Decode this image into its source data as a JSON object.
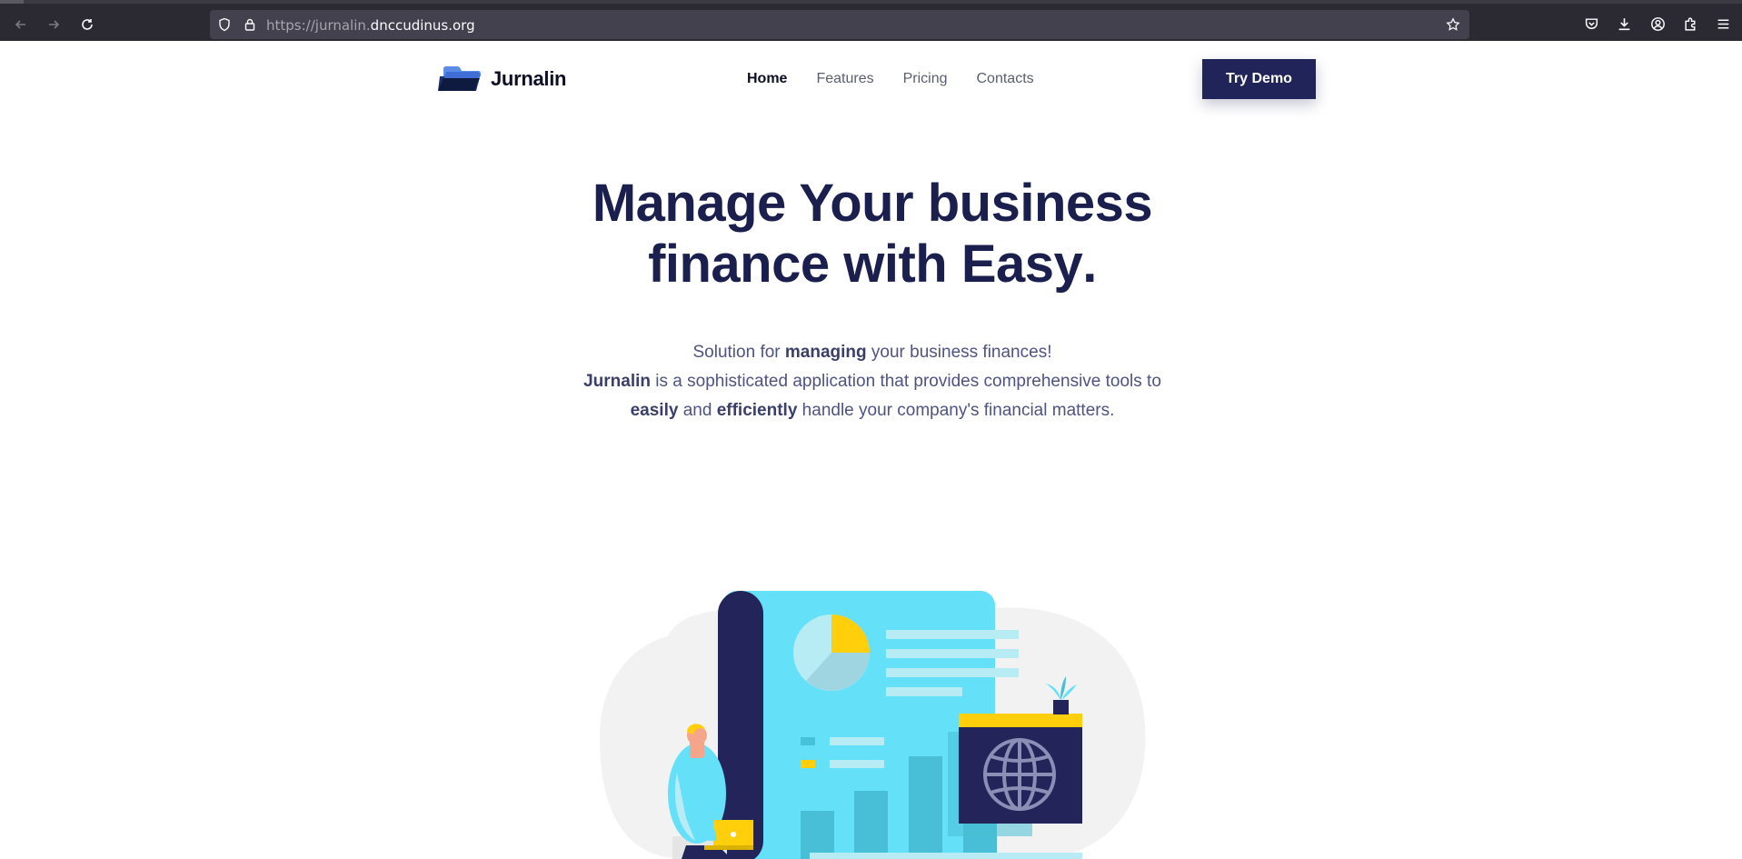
{
  "browser": {
    "url_protocol": "https://",
    "url_subdomain": "jurnalin.",
    "url_domain": "dnccudinus.org",
    "icons": [
      "back-icon",
      "forward-icon",
      "reload-icon",
      "shield-icon",
      "lock-icon",
      "star-icon",
      "pocket-icon",
      "download-icon",
      "account-icon",
      "extensions-icon",
      "menu-icon"
    ]
  },
  "site": {
    "brand": "Jurnalin",
    "nav": [
      {
        "label": "Home",
        "active": true
      },
      {
        "label": "Features",
        "active": false
      },
      {
        "label": "Pricing",
        "active": false
      },
      {
        "label": "Contacts",
        "active": false
      }
    ],
    "cta_label": "Try Demo",
    "colors": {
      "primary": "#212458",
      "accent": "#ffcf0b",
      "title": "#1a1f4e",
      "body": "#4e5380",
      "cyan": "#62e0f8"
    }
  },
  "hero": {
    "title_line1": "Manage Your business",
    "title_line2_pre": "finance with ",
    "title_highlight": "Easy",
    "title_line2_post": ".",
    "sub_1a": "Solution for ",
    "sub_1b": "managing",
    "sub_1c": " your business finances!",
    "sub_2a": "Jurnalin",
    "sub_2b": " is a sophisticated application that provides comprehensive tools to ",
    "sub_2c": "easily",
    "sub_2d": " and ",
    "sub_2e": "efficiently",
    "sub_2f": " handle your company's financial matters."
  }
}
